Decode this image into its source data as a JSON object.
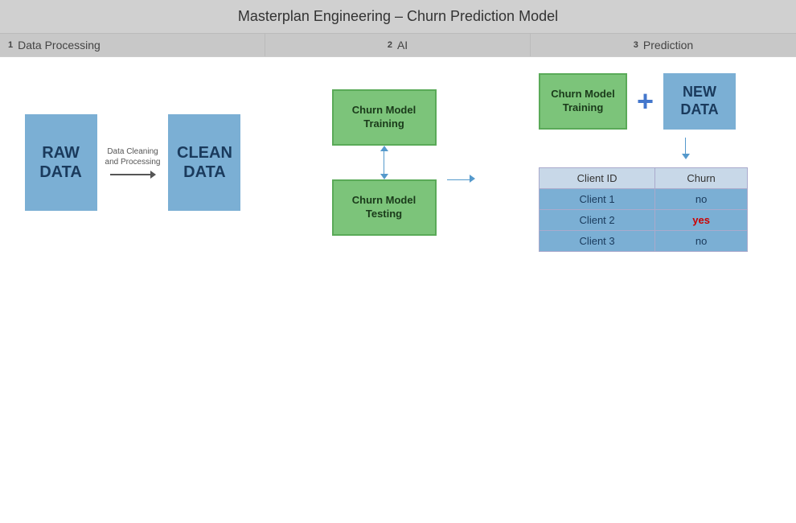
{
  "title": "Masterplan Engineering – Churn Prediction Model",
  "sections": [
    {
      "num": "1",
      "label": "Data Processing"
    },
    {
      "num": "2",
      "label": "AI"
    },
    {
      "num": "3",
      "label": "Prediction"
    }
  ],
  "s1": {
    "raw_data": "RAW DATA",
    "arrow_label": "Data Cleaning\nand Processing",
    "clean_data": "CLEAN DATA"
  },
  "s2": {
    "training_label": "Churn Model\nTraining",
    "testing_label": "Churn Model\nTesting"
  },
  "s3": {
    "training_label": "Churn Model\nTraining",
    "new_data_label": "NEW DATA",
    "plus": "+",
    "table": {
      "headers": [
        "Client ID",
        "Churn"
      ],
      "rows": [
        {
          "client": "Client 1",
          "churn": "no",
          "highlight": false
        },
        {
          "client": "Client 2",
          "churn": "yes",
          "highlight": true
        },
        {
          "client": "Client 3",
          "churn": "no",
          "highlight": false
        }
      ]
    }
  }
}
